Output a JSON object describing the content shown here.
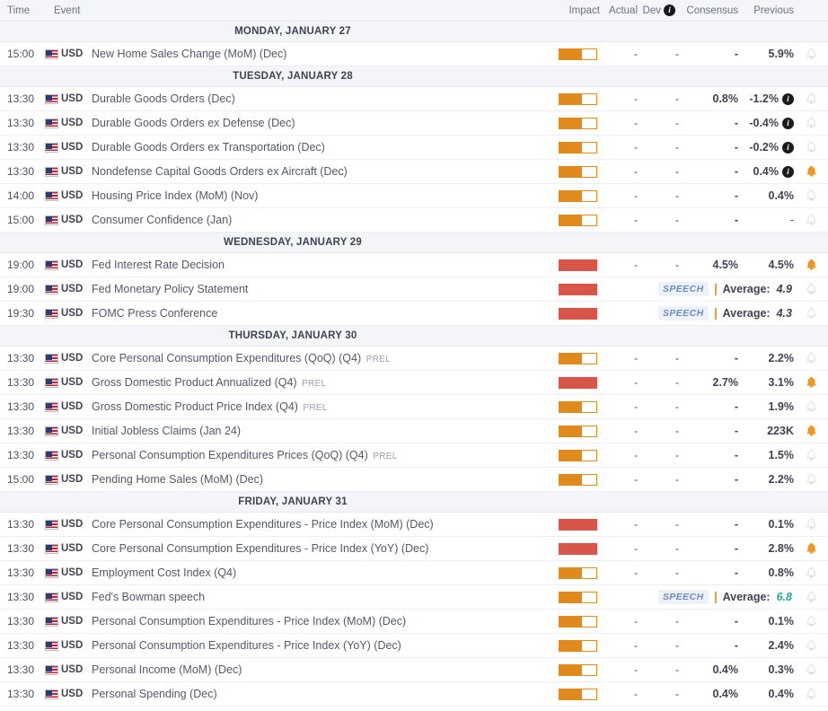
{
  "header": {
    "time": "Time",
    "event": "Event",
    "impact": "Impact",
    "actual": "Actual",
    "dev": "Dev",
    "dev_icon": "info-icon",
    "consensus": "Consensus",
    "previous": "Previous"
  },
  "colors": {
    "impact_medium": "#e08a1e",
    "impact_high": "#d8554a",
    "bell_active": "#ef9523",
    "bell_inactive": "#d6d8de",
    "speech_badge_text": "#6c8cc4",
    "teal_value": "#2aa79b"
  },
  "days": [
    {
      "label": "MONDAY, JANUARY 27",
      "events": [
        {
          "time": "15:00",
          "currency": "USD",
          "name": "New Home Sales Change (MoM) (Dec)",
          "prel": "",
          "impact": "medium",
          "actual": "-",
          "dev": "-",
          "consensus": "-",
          "previous": "5.9%",
          "info": false,
          "alert": false,
          "type": "data"
        }
      ]
    },
    {
      "label": "TUESDAY, JANUARY 28",
      "events": [
        {
          "time": "13:30",
          "currency": "USD",
          "name": "Durable Goods Orders (Dec)",
          "prel": "",
          "impact": "medium",
          "actual": "-",
          "dev": "-",
          "consensus": "0.8%",
          "previous": "-1.2%",
          "info": true,
          "alert": false,
          "type": "data"
        },
        {
          "time": "13:30",
          "currency": "USD",
          "name": "Durable Goods Orders ex Defense (Dec)",
          "prel": "",
          "impact": "medium",
          "actual": "-",
          "dev": "-",
          "consensus": "-",
          "previous": "-0.4%",
          "info": true,
          "alert": false,
          "type": "data"
        },
        {
          "time": "13:30",
          "currency": "USD",
          "name": "Durable Goods Orders ex Transportation (Dec)",
          "prel": "",
          "impact": "medium",
          "actual": "-",
          "dev": "-",
          "consensus": "-",
          "previous": "-0.2%",
          "info": true,
          "alert": false,
          "type": "data"
        },
        {
          "time": "13:30",
          "currency": "USD",
          "name": "Nondefense Capital Goods Orders ex Aircraft (Dec)",
          "prel": "",
          "impact": "medium",
          "actual": "-",
          "dev": "-",
          "consensus": "-",
          "previous": "0.4%",
          "info": true,
          "alert": true,
          "type": "data"
        },
        {
          "time": "14:00",
          "currency": "USD",
          "name": "Housing Price Index (MoM) (Nov)",
          "prel": "",
          "impact": "medium",
          "actual": "-",
          "dev": "-",
          "consensus": "-",
          "previous": "0.4%",
          "info": false,
          "alert": false,
          "type": "data"
        },
        {
          "time": "15:00",
          "currency": "USD",
          "name": "Consumer Confidence (Jan)",
          "prel": "",
          "impact": "medium",
          "actual": "-",
          "dev": "-",
          "consensus": "-",
          "previous": "-",
          "info": false,
          "alert": false,
          "type": "data"
        }
      ]
    },
    {
      "label": "WEDNESDAY, JANUARY 29",
      "events": [
        {
          "time": "19:00",
          "currency": "USD",
          "name": "Fed Interest Rate Decision",
          "prel": "",
          "impact": "high",
          "actual": "-",
          "dev": "-",
          "consensus": "4.5%",
          "previous": "4.5%",
          "info": false,
          "alert": true,
          "type": "data"
        },
        {
          "time": "19:00",
          "currency": "USD",
          "name": "Fed Monetary Policy Statement",
          "prel": "",
          "impact": "high",
          "speech_badge": "SPEECH",
          "average_label": "Average:",
          "average_value": "4.9",
          "average_teal": false,
          "alert": false,
          "type": "speech"
        },
        {
          "time": "19:30",
          "currency": "USD",
          "name": "FOMC Press Conference",
          "prel": "",
          "impact": "high",
          "speech_badge": "SPEECH",
          "average_label": "Average:",
          "average_value": "4.3",
          "average_teal": false,
          "alert": false,
          "type": "speech"
        }
      ]
    },
    {
      "label": "THURSDAY, JANUARY 30",
      "events": [
        {
          "time": "13:30",
          "currency": "USD",
          "name": "Core Personal Consumption Expenditures (QoQ) (Q4)",
          "prel": "PREL",
          "impact": "medium",
          "actual": "-",
          "dev": "-",
          "consensus": "-",
          "previous": "2.2%",
          "info": false,
          "alert": false,
          "type": "data"
        },
        {
          "time": "13:30",
          "currency": "USD",
          "name": "Gross Domestic Product Annualized (Q4)",
          "prel": "PREL",
          "impact": "high",
          "actual": "-",
          "dev": "-",
          "consensus": "2.7%",
          "previous": "3.1%",
          "info": false,
          "alert": true,
          "type": "data"
        },
        {
          "time": "13:30",
          "currency": "USD",
          "name": "Gross Domestic Product Price Index (Q4)",
          "prel": "PREL",
          "impact": "medium",
          "actual": "-",
          "dev": "-",
          "consensus": "-",
          "previous": "1.9%",
          "info": false,
          "alert": false,
          "type": "data"
        },
        {
          "time": "13:30",
          "currency": "USD",
          "name": "Initial Jobless Claims (Jan 24)",
          "prel": "",
          "impact": "medium",
          "actual": "-",
          "dev": "-",
          "consensus": "-",
          "previous": "223K",
          "info": false,
          "alert": true,
          "type": "data"
        },
        {
          "time": "13:30",
          "currency": "USD",
          "name": "Personal Consumption Expenditures Prices (QoQ) (Q4)",
          "prel": "PREL",
          "impact": "medium",
          "actual": "-",
          "dev": "-",
          "consensus": "-",
          "previous": "1.5%",
          "info": false,
          "alert": false,
          "type": "data"
        },
        {
          "time": "15:00",
          "currency": "USD",
          "name": "Pending Home Sales (MoM) (Dec)",
          "prel": "",
          "impact": "medium",
          "actual": "-",
          "dev": "-",
          "consensus": "-",
          "previous": "2.2%",
          "info": false,
          "alert": false,
          "type": "data"
        }
      ]
    },
    {
      "label": "FRIDAY, JANUARY 31",
      "events": [
        {
          "time": "13:30",
          "currency": "USD",
          "name": "Core Personal Consumption Expenditures - Price Index (MoM) (Dec)",
          "prel": "",
          "impact": "high",
          "actual": "-",
          "dev": "-",
          "consensus": "-",
          "previous": "0.1%",
          "info": false,
          "alert": false,
          "type": "data"
        },
        {
          "time": "13:30",
          "currency": "USD",
          "name": "Core Personal Consumption Expenditures - Price Index (YoY) (Dec)",
          "prel": "",
          "impact": "high",
          "actual": "-",
          "dev": "-",
          "consensus": "-",
          "previous": "2.8%",
          "info": false,
          "alert": true,
          "type": "data"
        },
        {
          "time": "13:30",
          "currency": "USD",
          "name": "Employment Cost Index (Q4)",
          "prel": "",
          "impact": "medium",
          "actual": "-",
          "dev": "-",
          "consensus": "-",
          "previous": "0.8%",
          "info": false,
          "alert": false,
          "type": "data"
        },
        {
          "time": "13:30",
          "currency": "USD",
          "name": "Fed's Bowman speech",
          "prel": "",
          "impact": "medium",
          "speech_badge": "SPEECH",
          "average_label": "Average:",
          "average_value": "6.8",
          "average_teal": true,
          "alert": false,
          "type": "speech"
        },
        {
          "time": "13:30",
          "currency": "USD",
          "name": "Personal Consumption Expenditures - Price Index (MoM) (Dec)",
          "prel": "",
          "impact": "medium",
          "actual": "-",
          "dev": "-",
          "consensus": "-",
          "previous": "0.1%",
          "info": false,
          "alert": false,
          "type": "data"
        },
        {
          "time": "13:30",
          "currency": "USD",
          "name": "Personal Consumption Expenditures - Price Index (YoY) (Dec)",
          "prel": "",
          "impact": "medium",
          "actual": "-",
          "dev": "-",
          "consensus": "-",
          "previous": "2.4%",
          "info": false,
          "alert": false,
          "type": "data"
        },
        {
          "time": "13:30",
          "currency": "USD",
          "name": "Personal Income (MoM) (Dec)",
          "prel": "",
          "impact": "medium",
          "actual": "-",
          "dev": "-",
          "consensus": "0.4%",
          "previous": "0.3%",
          "info": false,
          "alert": false,
          "type": "data"
        },
        {
          "time": "13:30",
          "currency": "USD",
          "name": "Personal Spending (Dec)",
          "prel": "",
          "impact": "medium",
          "actual": "-",
          "dev": "-",
          "consensus": "0.4%",
          "previous": "0.4%",
          "info": false,
          "alert": false,
          "type": "data"
        }
      ]
    }
  ]
}
